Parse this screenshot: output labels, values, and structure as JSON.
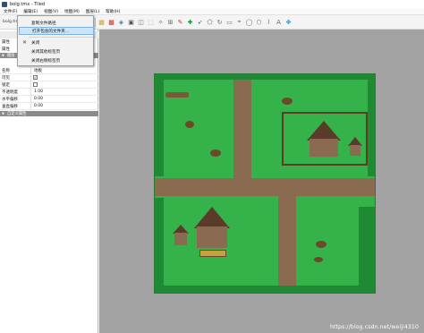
{
  "window": {
    "title": "bolg.tmx - Tiled"
  },
  "menubar": {
    "items": [
      "文件(F)",
      "编辑(E)",
      "视图(V)",
      "地图(M)",
      "图层(L)",
      "帮助(H)"
    ]
  },
  "file_tab": {
    "label": "bolg.tm"
  },
  "context_menu": {
    "items": [
      {
        "label": "复制文件路径"
      },
      {
        "label": "打开包含的文件夹..."
      },
      {
        "label": "关闭",
        "icon": "close-icon"
      },
      {
        "label": "关闭其他标签页"
      },
      {
        "label": "关闭右侧标签页"
      }
    ]
  },
  "left_panel": {
    "tab1": "属性",
    "tab2": "属性",
    "section_layer": "图层",
    "section_custom": "自定义属性",
    "props": [
      {
        "key": "名称",
        "value": "地板"
      },
      {
        "key": "可见",
        "value": "✓"
      },
      {
        "key": "锁定",
        "value": ""
      },
      {
        "key": "不透明度",
        "value": "1.00"
      },
      {
        "key": "水平偏移",
        "value": "0.00"
      },
      {
        "key": "垂直偏移",
        "value": "0.00"
      }
    ]
  },
  "watermark": {
    "text": "https://blog.csdn.net/weiji4310"
  },
  "colors": {
    "grass": "#36b24a",
    "path": "#8a6b4f",
    "tree": "#1e8a34",
    "canvas_bg": "#a3a3a3",
    "menu_highlight": "#cde4f7"
  }
}
